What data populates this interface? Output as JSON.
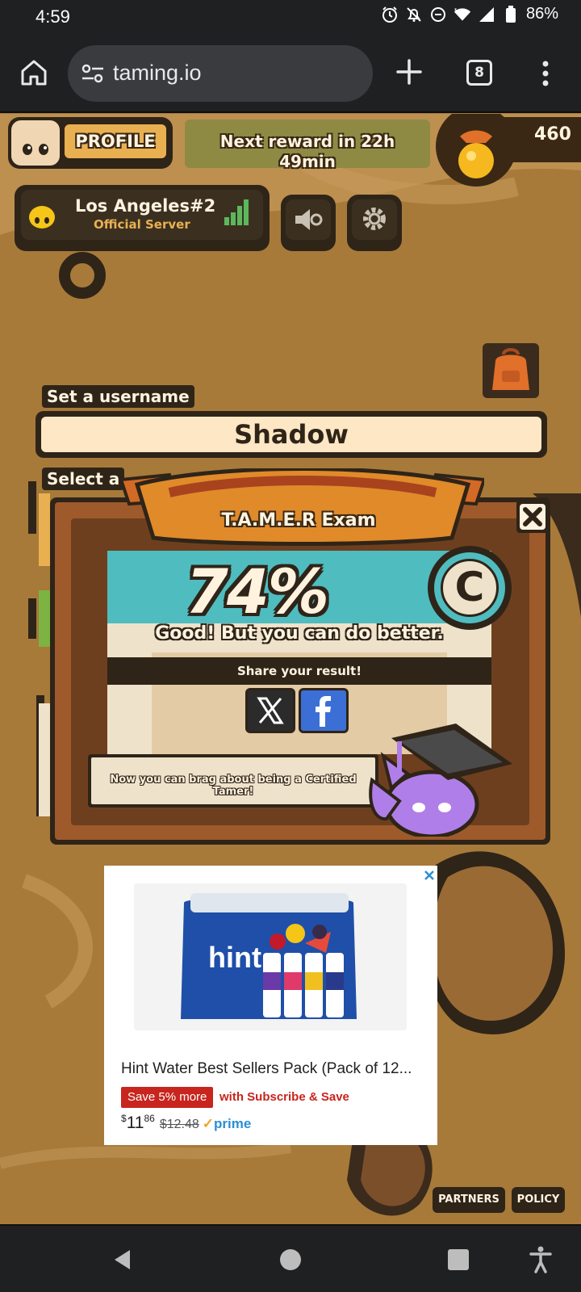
{
  "status_bar": {
    "time": "4:59",
    "battery": "86%"
  },
  "browser": {
    "url": "taming.io",
    "tab_count": "8"
  },
  "game": {
    "profile_label": "PROFILE",
    "reward_line1": "Next reward in 22h",
    "reward_line2": "49min",
    "coins": "460",
    "server_name": "Los Angeles#2",
    "server_type": "Official Server",
    "username_label": "Set a username",
    "username_value": "Shadow",
    "select_label": "Select a"
  },
  "modal": {
    "title": "T.A.M.E.R Exam",
    "score": "74%",
    "grade": "C",
    "feedback": "Good! But you can do better.",
    "share_label": "Share your result!",
    "brag_text": "Now you can brag about being a Certified Tamer!"
  },
  "ad": {
    "title": "Hint Water Best Sellers Pack (Pack of 12...",
    "save_badge": "Save 5% more",
    "save_sub": "with Subscribe & Save",
    "price_currency": "$",
    "price_whole": "11",
    "price_cents": "86",
    "price_old": "$12.48",
    "prime_label": "prime",
    "brand": "hint"
  },
  "footer": {
    "partners": "PARTNERS",
    "policy": "POLICY"
  },
  "colors": {
    "game_bg": "#a77a3a",
    "dark_outline": "#2f2418",
    "teal": "#4fbcc0",
    "cream": "#fff3df",
    "gold": "#e9b052"
  }
}
